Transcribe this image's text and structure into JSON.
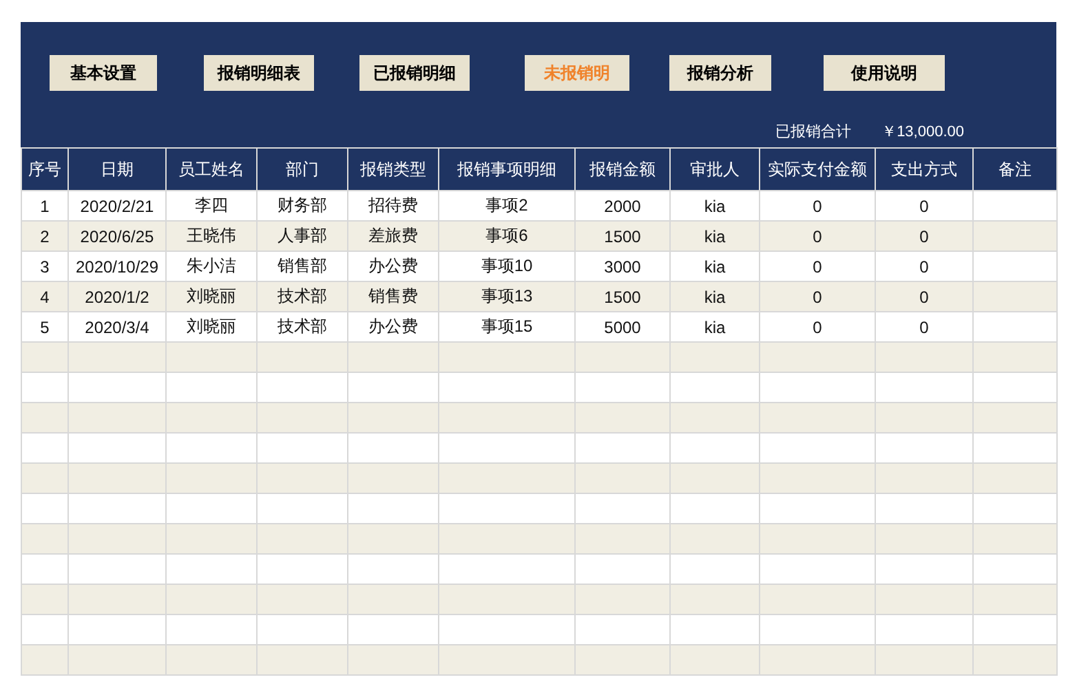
{
  "nav_buttons": [
    {
      "label": "基本设置",
      "selected": false
    },
    {
      "label": "报销明细表",
      "selected": false
    },
    {
      "label": "已报销明细",
      "selected": false
    },
    {
      "label": "未报销明",
      "selected": true
    },
    {
      "label": "报销分析",
      "selected": false
    },
    {
      "label": "使用说明",
      "selected": false
    }
  ],
  "summary": {
    "label": "已报销合计",
    "value": "￥13,000.00"
  },
  "table": {
    "columns": [
      "序号",
      "日期",
      "员工姓名",
      "部门",
      "报销类型",
      "报销事项明细",
      "报销金额",
      "审批人",
      "实际支付金额",
      "支出方式",
      "备注"
    ],
    "rows": [
      {
        "shaded": false,
        "cells": [
          "1",
          "2020/2/21",
          "李四",
          "财务部",
          "招待费",
          "事项2",
          "2000",
          "kia",
          "0",
          "0",
          null
        ]
      },
      {
        "shaded": true,
        "cells": [
          "2",
          "2020/6/25",
          "王晓伟",
          "人事部",
          "差旅费",
          "事项6",
          "1500",
          "kia",
          "0",
          "0",
          null
        ]
      },
      {
        "shaded": false,
        "cells": [
          "3",
          "2020/10/29",
          "朱小洁",
          "销售部",
          "办公费",
          "事项10",
          "3000",
          "kia",
          "0",
          "0",
          null
        ]
      },
      {
        "shaded": true,
        "cells": [
          "4",
          "2020/1/2",
          "刘晓丽",
          "技术部",
          "销售费",
          "事项13",
          "1500",
          "kia",
          "0",
          "0",
          null
        ]
      },
      {
        "shaded": false,
        "cells": [
          "5",
          "2020/3/4",
          "刘晓丽",
          "技术部",
          "办公费",
          "事项15",
          "5000",
          "kia",
          "0",
          "0",
          null
        ]
      },
      {
        "shaded": true
      },
      {
        "shaded": false
      },
      {
        "shaded": true
      },
      {
        "shaded": false
      },
      {
        "shaded": true
      },
      {
        "shaded": false
      },
      {
        "shaded": true
      },
      {
        "shaded": false
      },
      {
        "shaded": true
      },
      {
        "shaded": false
      },
      {
        "shaded": true
      }
    ]
  }
}
